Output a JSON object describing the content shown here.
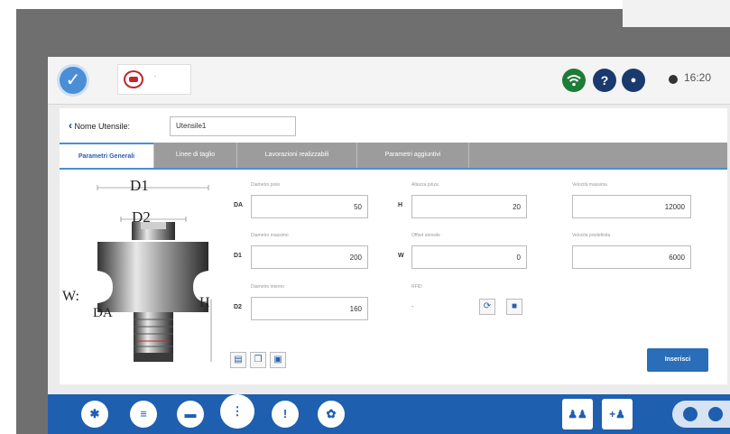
{
  "status": {
    "time": "16:20"
  },
  "header": {
    "logo_text": "-"
  },
  "tool_name": {
    "label": "Nome Utensile:",
    "value": "Utensile1"
  },
  "tabs": [
    {
      "label": "Parametri Generali",
      "active": true
    },
    {
      "label": "Linee di taglio",
      "active": false
    },
    {
      "label": "Lavorazioni realizzabili",
      "active": false
    },
    {
      "label": "Parametri aggiuntivi",
      "active": false
    }
  ],
  "diagram": {
    "d1": "D1",
    "d2": "D2",
    "w": "W:",
    "da": "DA",
    "h": "H"
  },
  "fields": {
    "da": {
      "prefix": "DA",
      "label": "Diametro piolo",
      "value": "50"
    },
    "d1": {
      "prefix": "D1",
      "label": "Diametro massimo",
      "value": "200"
    },
    "d2": {
      "prefix": "D2",
      "label": "Diametro interno",
      "value": "160"
    },
    "h": {
      "prefix": "H",
      "label": "Altezza pinza",
      "value": "20"
    },
    "w": {
      "prefix": "W",
      "label": "Offset utensile",
      "value": "0"
    },
    "rfid": {
      "label": "RFID",
      "value": "-"
    },
    "speed_max": {
      "label": "Velocità massima",
      "value": "12000"
    },
    "speed_default": {
      "label": "Velocità predefinita",
      "value": "6000"
    }
  },
  "insert_button": {
    "label": "Inserisci"
  },
  "colors": {
    "accent": "#2a6db8",
    "taskbar": "#1f5fb0",
    "wifi": "#1d7c36",
    "header_icons": "#1a3a6e"
  }
}
